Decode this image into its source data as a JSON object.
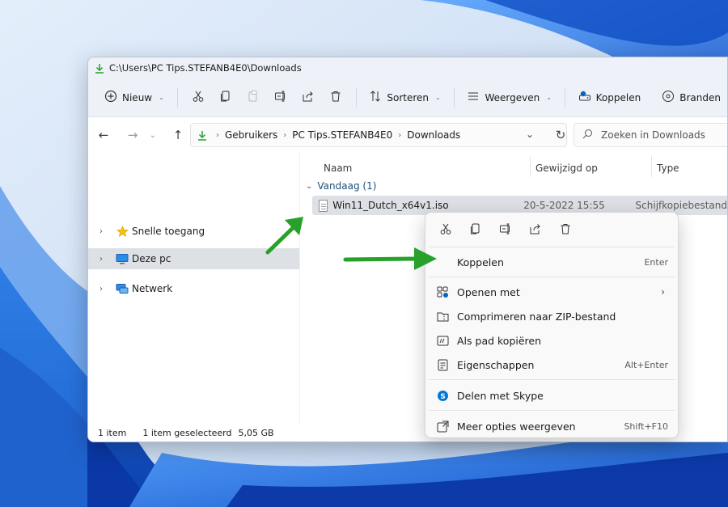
{
  "colors": {
    "accent": "#0067c0",
    "arrow": "#27a12a",
    "selection": "#dde0e4",
    "toolbar_bg": "#eef2f8"
  },
  "window": {
    "title": "C:\\Users\\PC Tips.STEFANB4E0\\Downloads"
  },
  "toolbar": {
    "new_label": "Nieuw",
    "sort_label": "Sorteren",
    "view_label": "Weergeven",
    "mount_label": "Koppelen",
    "burn_label": "Branden"
  },
  "navigation": {
    "breadcrumb": [
      "Gebruikers",
      "PC Tips.STEFANB4E0",
      "Downloads"
    ],
    "search_placeholder": "Zoeken in Downloads"
  },
  "sidebar": {
    "items": [
      {
        "label": "Snelle toegang",
        "icon": "star-icon"
      },
      {
        "label": "Deze pc",
        "icon": "computer-icon",
        "selected": true
      },
      {
        "label": "Netwerk",
        "icon": "network-icon"
      }
    ]
  },
  "file_list": {
    "columns": [
      "Naam",
      "Gewijzigd op",
      "Type"
    ],
    "group_label": "Vandaag (1)",
    "rows": [
      {
        "name": "Win11_Dutch_x64v1.iso",
        "modified": "20-5-2022 15:55",
        "type": "Schijfkopiebestand"
      }
    ]
  },
  "status": {
    "count": "1 item",
    "selected": "1 item geselecteerd",
    "size": "5,05 GB"
  },
  "context_menu": {
    "quick_actions": [
      "cut-icon",
      "copy-icon",
      "rename-icon",
      "share-icon",
      "delete-icon"
    ],
    "items": [
      {
        "label": "Koppelen",
        "shortcut": "Enter"
      },
      {
        "label": "Openen met",
        "submenu": "›"
      },
      {
        "label": "Comprimeren naar ZIP-bestand"
      },
      {
        "label": "Als pad kopiëren"
      },
      {
        "label": "Eigenschappen",
        "shortcut": "Alt+Enter"
      },
      {
        "label": "Delen met Skype"
      },
      {
        "label": "Meer opties weergeven",
        "shortcut": "Shift+F10"
      }
    ]
  }
}
